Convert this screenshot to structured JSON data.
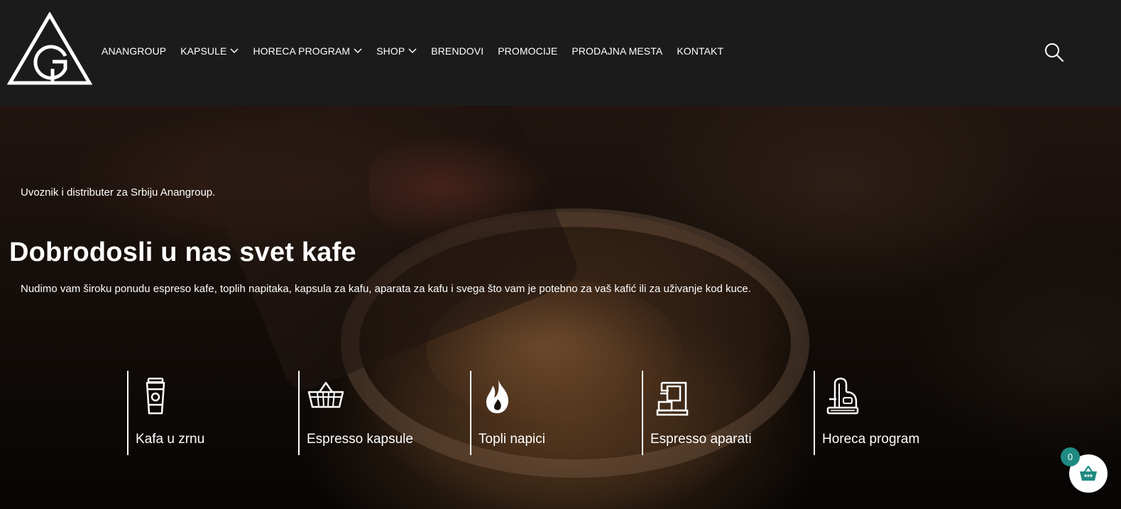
{
  "header": {
    "logo_letter": "G",
    "nav": [
      {
        "label": "ANANGROUP",
        "dropdown": false
      },
      {
        "label": "KAPSULE",
        "dropdown": true
      },
      {
        "label": "HORECA PROGRAM",
        "dropdown": true
      },
      {
        "label": "SHOP",
        "dropdown": true
      },
      {
        "label": "BRENDOVI",
        "dropdown": false
      },
      {
        "label": "PROMOCIJE",
        "dropdown": false
      },
      {
        "label": "PRODAJNA MESTA",
        "dropdown": false
      },
      {
        "label": "KONTAKT",
        "dropdown": false
      }
    ],
    "search_icon": "search-icon"
  },
  "hero": {
    "tagline": "Uvoznik i distributer za Srbiju Anangroup.",
    "title": "Dobrodosli u nas svet kafe",
    "description": "Nudimo vam široku ponudu espreso kafe, toplih napitaka, kapsula za kafu, aparata za kafu i svega što vam je potebno za vaš kafić ili za uživanje kod kuce."
  },
  "categories": [
    {
      "label": "Kafa u zrnu",
      "icon": "coffee-cup-icon"
    },
    {
      "label": "Espresso kapsule",
      "icon": "basket-icon"
    },
    {
      "label": "Topli napici",
      "icon": "flame-icon"
    },
    {
      "label": "Espresso aparati",
      "icon": "espresso-machine-icon"
    },
    {
      "label": "Horeca program",
      "icon": "coffee-machine-icon"
    }
  ],
  "cart": {
    "count": "0",
    "badge_color": "#1f8a82",
    "icon": "basket-icon"
  },
  "colors": {
    "header_bg": "#1b1b1b",
    "text": "#ffffff",
    "accent": "#1f8a82"
  }
}
